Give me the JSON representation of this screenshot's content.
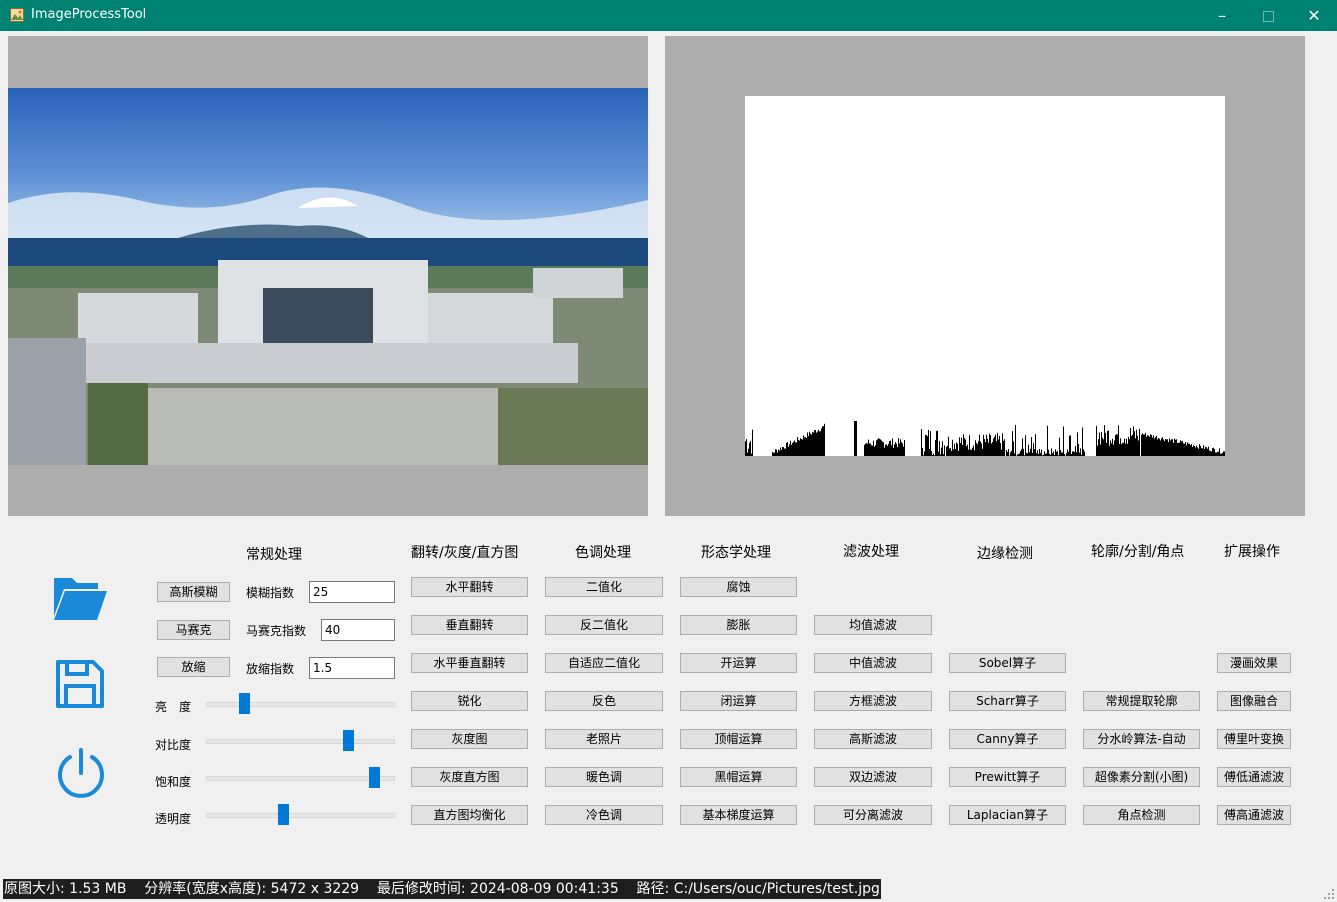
{
  "window": {
    "title": "ImageProcessTool"
  },
  "colors": {
    "titlebar": "#008272",
    "accent_blue": "#0078d7",
    "panel_gray": "#adadad"
  },
  "icons": [
    "open-folder-icon",
    "save-floppy-icon",
    "power-icon"
  ],
  "headings": {
    "general": "常规处理",
    "flip": "翻转/灰度/直方图",
    "tone": "色调处理",
    "morph": "形态学处理",
    "filter": "滤波处理",
    "edge": "边缘检测",
    "contour": "轮廓/分割/角点",
    "extend": "扩展操作"
  },
  "general": {
    "blur_button": "高斯模糊",
    "blur_label": "模糊指数",
    "blur_value": "25",
    "mosaic_button": "马赛克",
    "mosaic_label": "马赛克指数",
    "mosaic_value": "40",
    "scale_button": "放缩",
    "scale_label": "放缩指数",
    "scale_value": "1.5"
  },
  "sliders": [
    {
      "label": "亮　度",
      "value": 0.2
    },
    {
      "label": "对比度",
      "value": 0.75
    },
    {
      "label": "饱和度",
      "value": 0.89
    },
    {
      "label": "透明度",
      "value": 0.41
    }
  ],
  "flip_buttons": [
    "水平翻转",
    "垂直翻转",
    "水平垂直翻转",
    "锐化",
    "灰度图",
    "灰度直方图",
    "直方图均衡化"
  ],
  "tone_buttons": [
    "二值化",
    "反二值化",
    "自适应二值化",
    "反色",
    "老照片",
    "暖色调",
    "冷色调"
  ],
  "morph_buttons": [
    "腐蚀",
    "膨胀",
    "开运算",
    "闭运算",
    "顶帽运算",
    "黑帽运算",
    "基本梯度运算"
  ],
  "filter_buttons": [
    "均值滤波",
    "中值滤波",
    "方框滤波",
    "高斯滤波",
    "双边滤波",
    "可分离滤波"
  ],
  "edge_buttons": [
    "Sobel算子",
    "Scharr算子",
    "Canny算子",
    "Prewitt算子",
    "Laplacian算子"
  ],
  "contour_buttons": [
    "常规提取轮廓",
    "分水岭算法-自动",
    "超像素分割(小图)",
    "角点检测"
  ],
  "extend_buttons": [
    "漫画效果",
    "图像融合",
    "傅里叶变换",
    "傅低通滤波",
    "傅高通滤波"
  ],
  "status": {
    "text": "原图大小: 1.53 MB    分辨率(宽度x高度): 5472 x 3229    最后修改时间: 2024-08-09 00:41:35    路径: C:/Users/ouc/Pictures/test.jpg"
  }
}
